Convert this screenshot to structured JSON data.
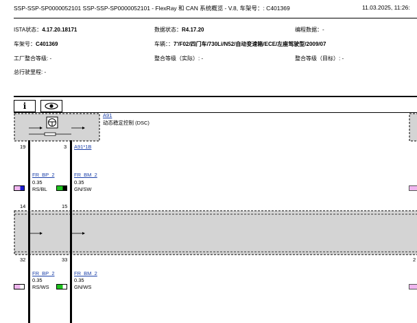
{
  "header": {
    "title": "SSP-SSP-SP0000052101  SSP-SSP-SP0000052101  - FlexRay 和 CAN 系统概览 - V.8, 车架号：: C401369",
    "date": "11.03.2025,  11:26:"
  },
  "info": {
    "ista_label": "ISTA状态：",
    "ista_value": "4.17.20.18171",
    "data_label": "数据状态：",
    "data_value": "R4.17.20",
    "code_label": "编程数据：-",
    "vin_label": "车架号：",
    "vin_value": "C401369",
    "vehicle_label": "车辆：：",
    "vehicle_value": "7'/F02/四门车/730Li/N52/自动变速箱/ECE/左座驾驶型/2009/07",
    "factory_level": "工厂整合等级: -",
    "level_actual": "整合等级（实际）: -",
    "level_target": "整合等级（目标）: -",
    "mileage": "总行驶里程: -"
  },
  "toolbar": {
    "info_symbol": "i",
    "view_icon": "eye-icon"
  },
  "module": {
    "id": "A91",
    "name": "动态稳定控制 (DSC)",
    "connector": "A91*1B"
  },
  "pins_top": {
    "left": "19",
    "right": "3"
  },
  "wires_upper": [
    {
      "name": "FR_BP_2",
      "size": "0.35",
      "color": "RS/BL"
    },
    {
      "name": "FR_BM_2",
      "size": "0.35",
      "color": "GN/SW"
    }
  ],
  "pins_mid": {
    "left": "14",
    "right": "15",
    "left2": "32",
    "right2": "33",
    "far": "2"
  },
  "wires_lower": [
    {
      "name": "FR_BP_2",
      "size": "0.35",
      "color": "RS/WS"
    },
    {
      "name": "FR_BM_2",
      "size": "0.35",
      "color": "GN/WS"
    }
  ],
  "colors": {
    "module_fill": "#d4d4d4",
    "link": "#1a3fa8",
    "pink": "#f0b6ef",
    "blue": "#1c1cd0",
    "green": "#1ec21e"
  }
}
